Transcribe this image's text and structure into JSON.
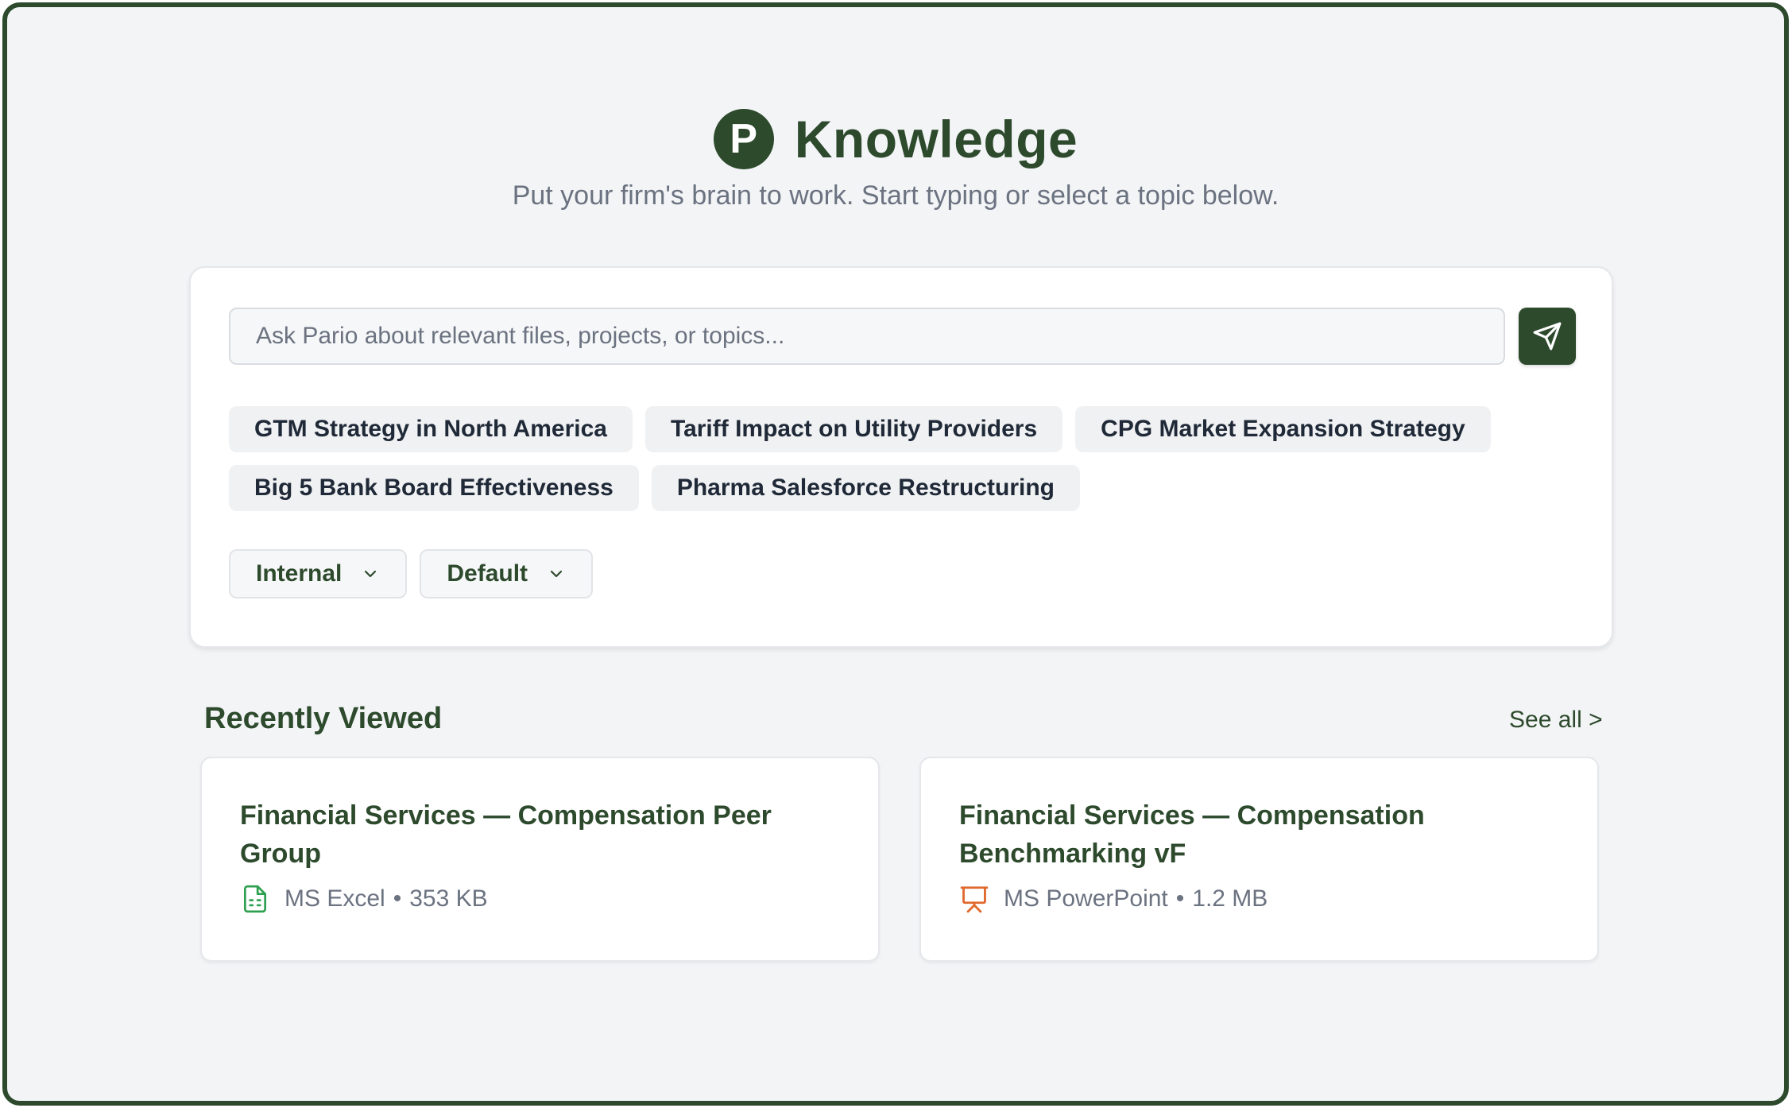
{
  "header": {
    "logo_letter": "P",
    "title": "Knowledge",
    "subtitle": "Put your firm's brain to work. Start typing or select a topic below."
  },
  "search": {
    "placeholder": "Ask Pario about relevant files, projects, or topics...",
    "value": ""
  },
  "topics_row1": [
    "GTM Strategy in North America",
    "Tariff Impact on Utility Providers",
    "CPG Market Expansion Strategy"
  ],
  "topics_row2": [
    "Big 5 Bank Board Effectiveness",
    "Pharma Salesforce Restructuring"
  ],
  "filters": {
    "source": "Internal",
    "mode": "Default"
  },
  "recent": {
    "title": "Recently Viewed",
    "see_all": "See all >",
    "items": [
      {
        "title": "Financial Services — Compensation Peer Group",
        "app": "MS Excel",
        "separator": "•",
        "size": "353 KB",
        "icon": "excel-file-icon",
        "icon_color": "#2e9e4f"
      },
      {
        "title": "Financial Services — Compensation Benchmarking vF",
        "app": "MS PowerPoint",
        "separator": "•",
        "size": "1.2 MB",
        "icon": "powerpoint-file-icon",
        "icon_color": "#e0692e"
      }
    ]
  },
  "colors": {
    "brand": "#2d4a2d",
    "background": "#f3f4f6",
    "muted_text": "#6b7280"
  }
}
